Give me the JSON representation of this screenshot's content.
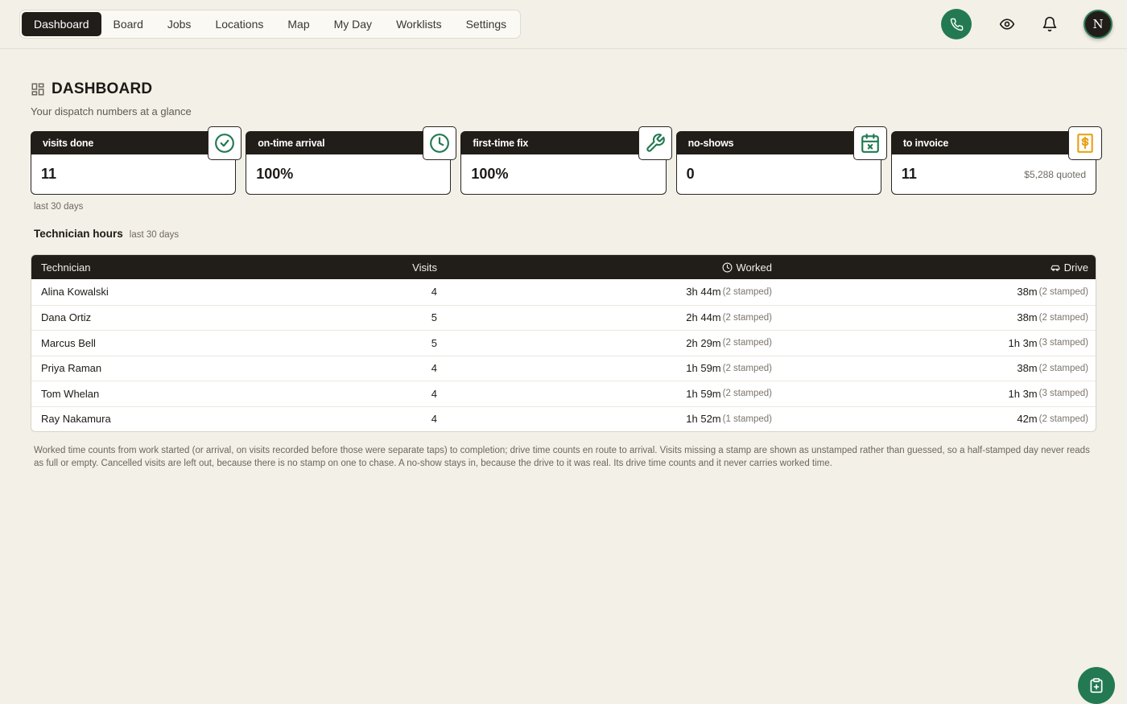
{
  "nav": {
    "items": [
      "Dashboard",
      "Board",
      "Jobs",
      "Locations",
      "Map",
      "My Day",
      "Worklists",
      "Settings"
    ],
    "active": "Dashboard"
  },
  "topbar": {
    "icons": [
      "phone-icon",
      "eye-icon",
      "bell-icon"
    ],
    "avatar_initial": "N"
  },
  "page": {
    "title": "DASHBOARD",
    "subtitle": "Your dispatch numbers at a glance"
  },
  "cards": [
    {
      "label": "visits done",
      "value": "11",
      "note": "",
      "icon": "check-circle-icon"
    },
    {
      "label": "on-time arrival",
      "value": "100%",
      "note": "",
      "icon": "clock-icon"
    },
    {
      "label": "first-time fix",
      "value": "100%",
      "note": "",
      "icon": "wrench-icon"
    },
    {
      "label": "no-shows",
      "value": "0",
      "note": "",
      "icon": "calendar-x-icon"
    },
    {
      "label": "to invoice",
      "value": "11",
      "note": "$5,288 quoted",
      "icon": "invoice-dollar-icon"
    }
  ],
  "range_label": "last 30 days",
  "section": {
    "title": "Technician hours",
    "subtitle": "last 30 days"
  },
  "table": {
    "headers": {
      "technician": "Technician",
      "visits": "Visits",
      "worked": "Worked",
      "drive": "Drive"
    },
    "rows": [
      {
        "name": "Alina Kowalski",
        "visits": "4",
        "worked": "3h 44m",
        "worked_stamp": "(2 stamped)",
        "drive": "38m",
        "drive_stamp": "(2 stamped)"
      },
      {
        "name": "Dana Ortiz",
        "visits": "5",
        "worked": "2h 44m",
        "worked_stamp": "(2 stamped)",
        "drive": "38m",
        "drive_stamp": "(2 stamped)"
      },
      {
        "name": "Marcus Bell",
        "visits": "5",
        "worked": "2h 29m",
        "worked_stamp": "(2 stamped)",
        "drive": "1h 3m",
        "drive_stamp": "(3 stamped)"
      },
      {
        "name": "Priya Raman",
        "visits": "4",
        "worked": "1h 59m",
        "worked_stamp": "(2 stamped)",
        "drive": "38m",
        "drive_stamp": "(2 stamped)"
      },
      {
        "name": "Tom Whelan",
        "visits": "4",
        "worked": "1h 59m",
        "worked_stamp": "(2 stamped)",
        "drive": "1h 3m",
        "drive_stamp": "(3 stamped)"
      },
      {
        "name": "Ray Nakamura",
        "visits": "4",
        "worked": "1h 52m",
        "worked_stamp": "(1 stamped)",
        "drive": "42m",
        "drive_stamp": "(2 stamped)"
      }
    ]
  },
  "footnote": "Worked time counts from work started (or arrival, on visits recorded before those were separate taps) to completion; drive time counts en route to arrival. Visits missing a stamp are shown as unstamped rather than guessed, so a half-stamped day never reads as full or empty. Cancelled visits are left out, because there is no stamp on one to chase. A no-show stays in, because the drive to it was real. Its drive time counts and it never carries worked time.",
  "colors": {
    "accent": "#237a52",
    "dark": "#211d19",
    "background": "#f3f0e8",
    "invoice_accent": "#e8a21a"
  }
}
